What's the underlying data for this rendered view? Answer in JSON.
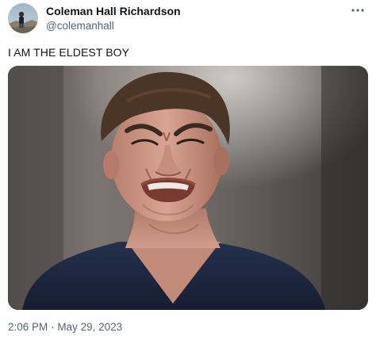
{
  "author": {
    "display_name": "Coleman Hall Richardson",
    "handle": "@colemanhall"
  },
  "tweet": {
    "text": "I AM THE ELDEST BOY",
    "time": "2:06 PM",
    "separator": "·",
    "date": "May 29, 2023"
  },
  "icons": {
    "more": "more-horizontal-icon"
  },
  "colors": {
    "text_primary": "#0f1419",
    "text_secondary": "#536471",
    "scrub_top": "#1f2a44"
  }
}
